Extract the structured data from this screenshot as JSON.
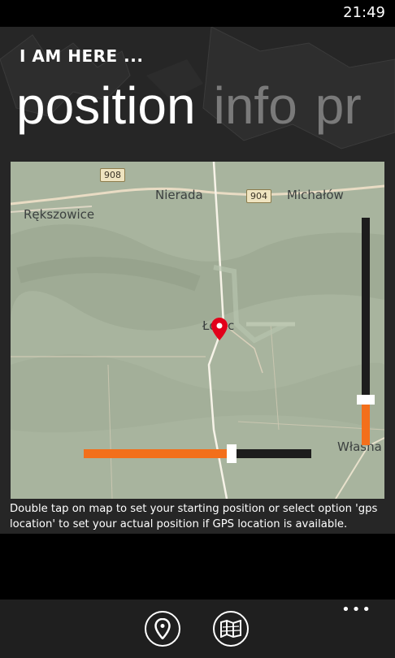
{
  "status": {
    "time": "21:49"
  },
  "app": {
    "title": "I AM HERE ..."
  },
  "pivot": {
    "items": [
      "position",
      "info",
      "pr"
    ],
    "active": "position"
  },
  "map": {
    "labels": {
      "nierada": "Nierada",
      "michalow": "Michałów",
      "rekszowice": "Rększowice",
      "lojec": "Łojec",
      "wlasna": "Własna"
    },
    "road_signs": {
      "r908": "908",
      "r904": "904"
    },
    "vertical_slider": {
      "value": 0.2
    },
    "horizontal_slider": {
      "value": 0.65
    }
  },
  "hint": {
    "text": "Double tap on map to set your starting position or select option 'gps location' to set your actual position if GPS location is available."
  },
  "appbar": {
    "more": "•••",
    "buttons": [
      "location-pin-icon",
      "map-icon"
    ]
  },
  "colors": {
    "accent": "#f36f1b",
    "pin": "#e2001a",
    "map": "#a7b39d"
  }
}
